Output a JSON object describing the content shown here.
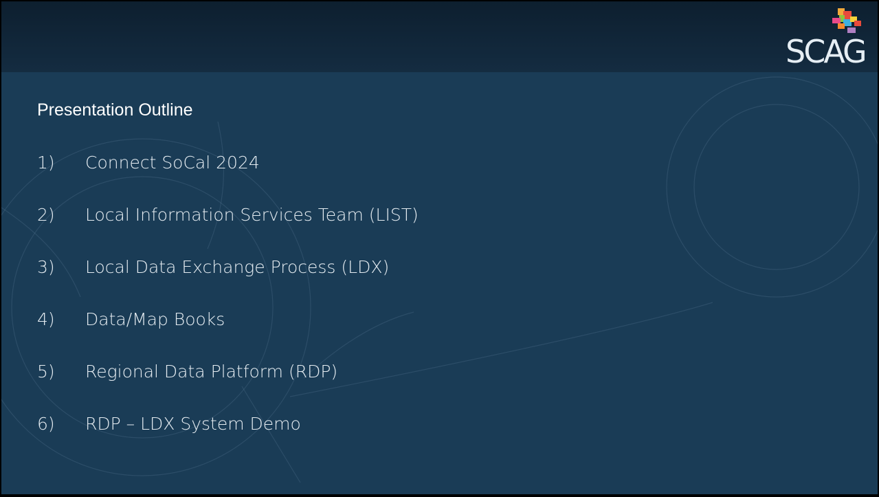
{
  "slide": {
    "title": "Presentation Outline",
    "items": [
      {
        "num": "1)",
        "text": "Connect SoCal 2024"
      },
      {
        "num": "2)",
        "text": "Local Information Services Team (LIST)"
      },
      {
        "num": "3)",
        "text": "Local Data Exchange Process (LDX)"
      },
      {
        "num": "4)",
        "text": "Data/Map Books"
      },
      {
        "num": "5)",
        "text": "Regional Data Platform (RDP)"
      },
      {
        "num": "6)",
        "text": "RDP – LDX System Demo"
      }
    ]
  },
  "logo": {
    "text": "SCAG",
    "mark_icon": "scag-colored-blocks-icon"
  },
  "colors": {
    "background": "#1a3c56",
    "header": "#0f2233",
    "text": "#ffffff"
  }
}
